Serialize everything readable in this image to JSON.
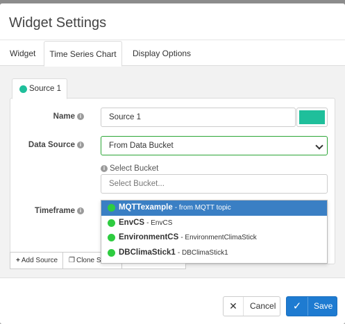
{
  "modal": {
    "title": "Widget Settings"
  },
  "tabs": [
    {
      "label": "Widget"
    },
    {
      "label": "Time Series Chart"
    },
    {
      "label": "Display Options"
    }
  ],
  "source": {
    "tab_label": "Source 1",
    "color": "#1fbf9b",
    "name_label": "Name",
    "name_value": "Source 1",
    "data_source_label": "Data Source",
    "data_source_value": "From Data Bucket",
    "select_bucket_hint": "Select Bucket",
    "bucket_placeholder": "Select Bucket...",
    "timeframe_label": "Timeframe"
  },
  "bucket_options": [
    {
      "name": "MQTTexample",
      "desc": "- from MQTT topic",
      "selected": true
    },
    {
      "name": "EnvCS",
      "desc": "- EnvCS",
      "selected": false
    },
    {
      "name": "EnvironmentCS",
      "desc": "- EnvironmentClimaStick",
      "selected": false
    },
    {
      "name": "DBClimaStick1",
      "desc": "- DBClimaStick1",
      "selected": false
    }
  ],
  "source_buttons": {
    "add": "Add Source",
    "clone": "Clone So"
  },
  "footer": {
    "cancel": "Cancel",
    "save": "Save"
  },
  "colors": {
    "accent_green": "#2ecc40",
    "source_teal": "#1fbf9b",
    "save_blue": "#1e7bd1",
    "selected_blue": "#3a7fc4"
  }
}
